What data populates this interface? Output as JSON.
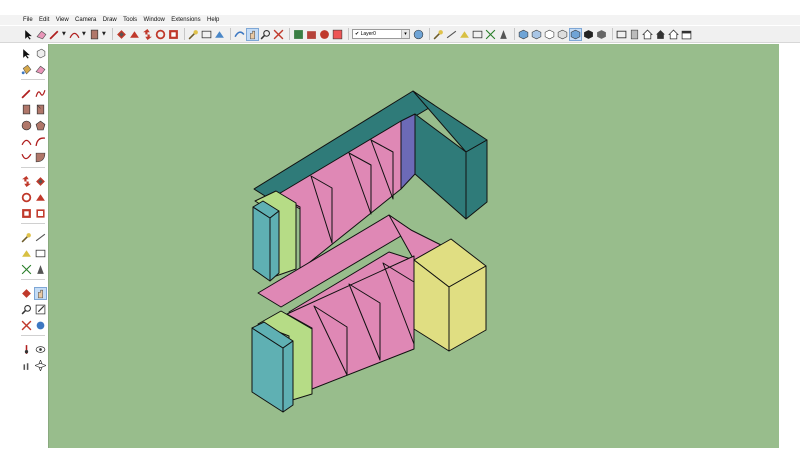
{
  "menu": {
    "items": [
      "File",
      "Edit",
      "View",
      "Camera",
      "Draw",
      "Tools",
      "Window",
      "Extensions",
      "Help"
    ]
  },
  "toolbar": {
    "layer_check": "✔",
    "layer_name": "Layer0",
    "icons_group1": [
      "select-arrow-icon",
      "eraser-icon",
      "pencil-line-icon",
      "arc-icon",
      "rectangle-icon",
      "push-pull-icon",
      "follow-me-icon",
      "move-icon",
      "rotate-icon",
      "scale-icon"
    ],
    "icons_group2": [
      "tape-measure-icon",
      "dimension-icon",
      "protractor-icon",
      "orbit-icon",
      "pan-icon",
      "zoom-icon",
      "zoom-extents-icon"
    ],
    "icons_group3": [
      "warehouse-icon",
      "extension-warehouse-icon",
      "model-info-icon",
      "components-icon"
    ]
  },
  "colors": {
    "viewport": "#98bd8c",
    "pink": "#df88b5",
    "lime": "#b6dc86",
    "teal": "#2f7b79",
    "teal_light": "#5fb0b3",
    "indigo": "#6c6ab7",
    "yellow": "#e0de82"
  }
}
